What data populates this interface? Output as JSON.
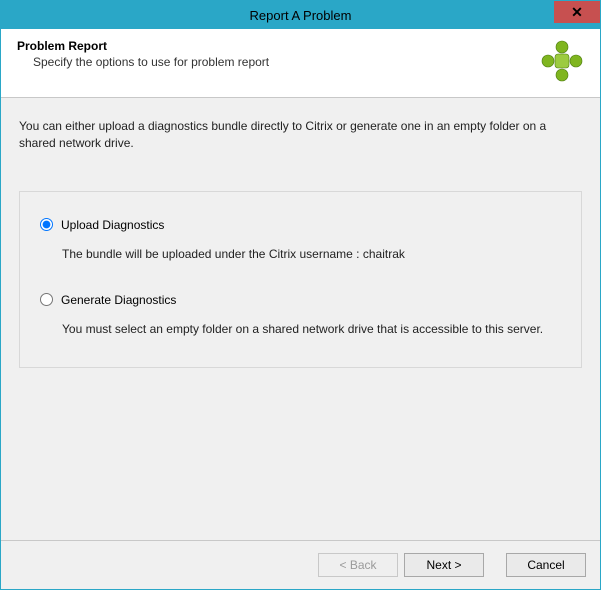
{
  "window": {
    "title": "Report A Problem",
    "close_symbol": "✕"
  },
  "header": {
    "title": "Problem Report",
    "subtitle": "Specify the options to use for problem report"
  },
  "content": {
    "intro": "You can either upload a diagnostics bundle directly to Citrix or generate one in an empty folder on a shared network drive.",
    "options": {
      "upload": {
        "label": "Upload Diagnostics",
        "description": "The bundle will be uploaded under the Citrix username : chaitrak",
        "selected": true
      },
      "generate": {
        "label": "Generate Diagnostics",
        "description": "You must select an empty folder on a shared network drive that is accessible to this server.",
        "selected": false
      }
    }
  },
  "footer": {
    "back_label": "< Back",
    "next_label": "Next >",
    "cancel_label": "Cancel"
  },
  "colors": {
    "titlebar": "#2aa7c7",
    "close": "#c75050",
    "content_bg": "#f0f0f0",
    "brand_green": "#7fb51f"
  }
}
